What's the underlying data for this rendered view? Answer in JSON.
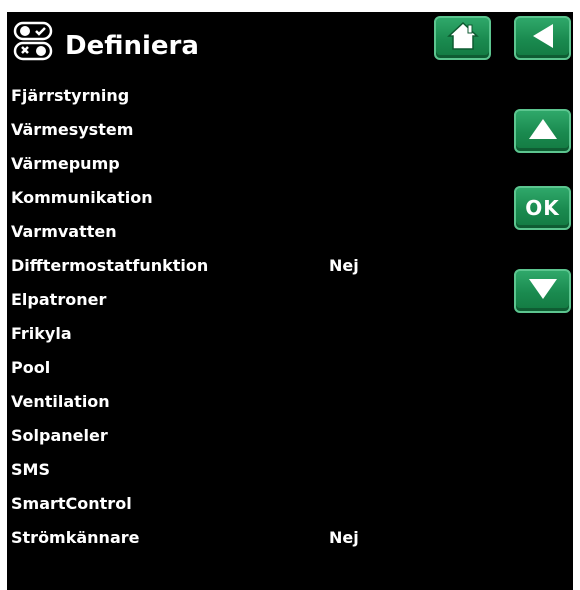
{
  "header": {
    "title": "Definiera",
    "icon": "toggle-switches-icon"
  },
  "buttons": {
    "home_icon": "home-icon",
    "back_icon": "back-arrow-icon",
    "up_icon": "up-arrow-icon",
    "ok_label": "OK",
    "down_icon": "down-arrow-icon"
  },
  "menu": {
    "items": [
      {
        "label": "Fjärrstyrning",
        "value": ""
      },
      {
        "label": "Värmesystem",
        "value": ""
      },
      {
        "label": "Värmepump",
        "value": ""
      },
      {
        "label": "Kommunikation",
        "value": ""
      },
      {
        "label": "Varmvatten",
        "value": ""
      },
      {
        "label": "Difftermostatfunktion",
        "value": "Nej"
      },
      {
        "label": "Elpatroner",
        "value": ""
      },
      {
        "label": "Frikyla",
        "value": ""
      },
      {
        "label": "Pool",
        "value": ""
      },
      {
        "label": "Ventilation",
        "value": ""
      },
      {
        "label": "Solpaneler",
        "value": ""
      },
      {
        "label": "SMS",
        "value": ""
      },
      {
        "label": "SmartControl",
        "value": ""
      },
      {
        "label": "Strömkännare",
        "value": "Nej"
      }
    ]
  },
  "colors": {
    "background": "#000000",
    "text": "#ffffff",
    "button_green": "#1a8a4f",
    "button_border": "#5cc58f"
  }
}
